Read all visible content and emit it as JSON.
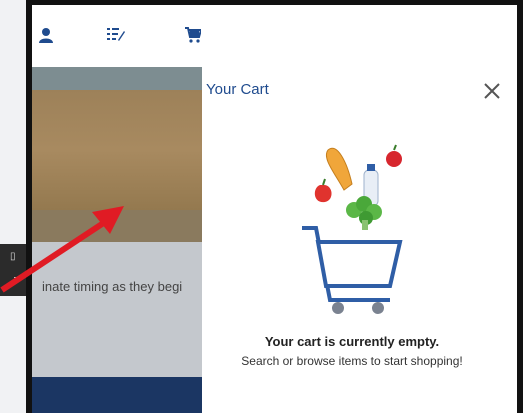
{
  "background": {
    "snippet_text": "inate timing as they begi"
  },
  "cart": {
    "title": "Your Cart",
    "empty_title": "Your cart is currently empty.",
    "empty_subtitle": "Search or browse items to start shopping!"
  },
  "colors": {
    "brand_blue": "#1f4b8e",
    "navy": "#1b3663",
    "arrow_red": "#e01b24"
  }
}
